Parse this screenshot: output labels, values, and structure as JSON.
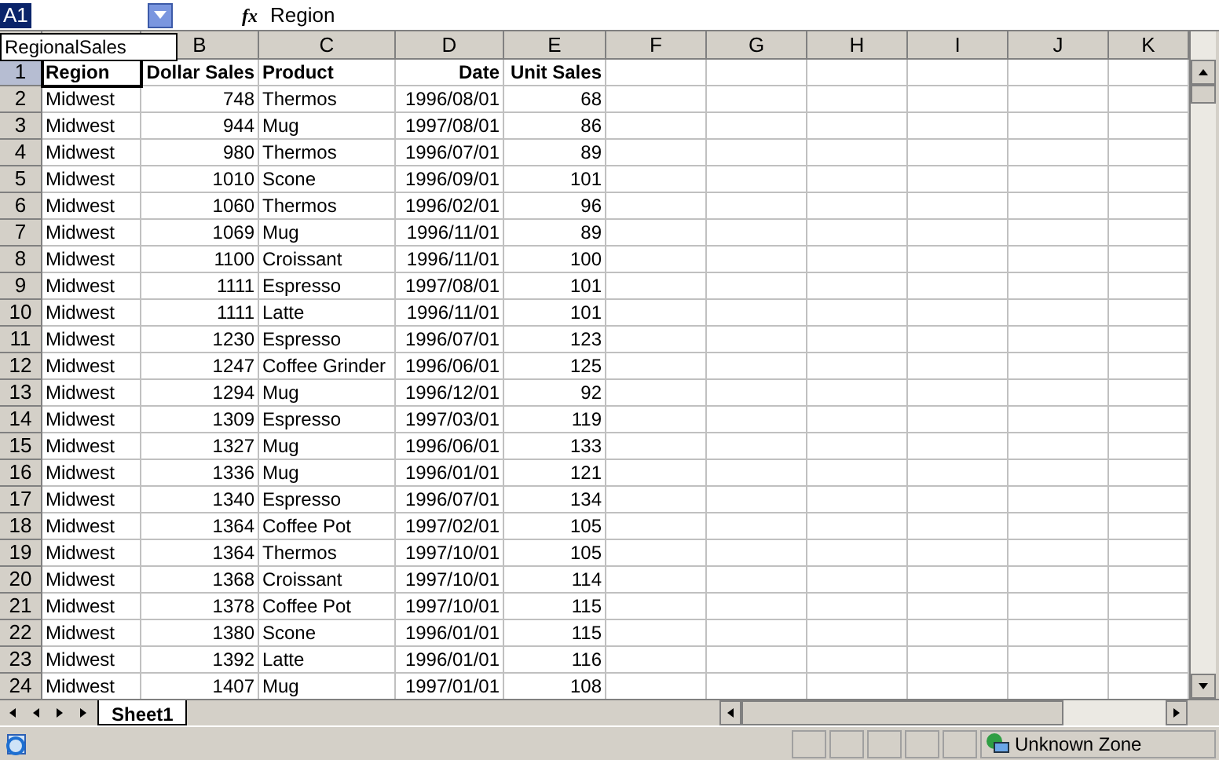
{
  "name_box": {
    "value": "A1"
  },
  "formula_bar": {
    "fx": "fx",
    "value": "Region"
  },
  "name_dropdown": {
    "item": "RegionalSales"
  },
  "column_headers": [
    "B",
    "C",
    "D",
    "E",
    "F",
    "G",
    "H",
    "I",
    "J",
    "K"
  ],
  "rows": [
    {
      "number": "1",
      "selected": true,
      "bold": true,
      "cells": [
        "Region",
        "Dollar Sales",
        "Product",
        "Date",
        "Unit Sales"
      ]
    },
    {
      "number": "2",
      "selected": false,
      "bold": false,
      "cells": [
        "Midwest",
        "748",
        "Thermos",
        "1996/08/01",
        "68"
      ]
    },
    {
      "number": "3",
      "selected": false,
      "bold": false,
      "cells": [
        "Midwest",
        "944",
        "Mug",
        "1997/08/01",
        "86"
      ]
    },
    {
      "number": "4",
      "selected": false,
      "bold": false,
      "cells": [
        "Midwest",
        "980",
        "Thermos",
        "1996/07/01",
        "89"
      ]
    },
    {
      "number": "5",
      "selected": false,
      "bold": false,
      "cells": [
        "Midwest",
        "1010",
        "Scone",
        "1996/09/01",
        "101"
      ]
    },
    {
      "number": "6",
      "selected": false,
      "bold": false,
      "cells": [
        "Midwest",
        "1060",
        "Thermos",
        "1996/02/01",
        "96"
      ]
    },
    {
      "number": "7",
      "selected": false,
      "bold": false,
      "cells": [
        "Midwest",
        "1069",
        "Mug",
        "1996/11/01",
        "89"
      ]
    },
    {
      "number": "8",
      "selected": false,
      "bold": false,
      "cells": [
        "Midwest",
        "1100",
        "Croissant",
        "1996/11/01",
        "100"
      ]
    },
    {
      "number": "9",
      "selected": false,
      "bold": false,
      "cells": [
        "Midwest",
        "1111",
        "Espresso",
        "1997/08/01",
        "101"
      ]
    },
    {
      "number": "10",
      "selected": false,
      "bold": false,
      "cells": [
        "Midwest",
        "1111",
        "Latte",
        "1996/11/01",
        "101"
      ]
    },
    {
      "number": "11",
      "selected": false,
      "bold": false,
      "cells": [
        "Midwest",
        "1230",
        "Espresso",
        "1996/07/01",
        "123"
      ]
    },
    {
      "number": "12",
      "selected": false,
      "bold": false,
      "cells": [
        "Midwest",
        "1247",
        "Coffee Grinder",
        "1996/06/01",
        "125"
      ]
    },
    {
      "number": "13",
      "selected": false,
      "bold": false,
      "cells": [
        "Midwest",
        "1294",
        "Mug",
        "1996/12/01",
        "92"
      ]
    },
    {
      "number": "14",
      "selected": false,
      "bold": false,
      "cells": [
        "Midwest",
        "1309",
        "Espresso",
        "1997/03/01",
        "119"
      ]
    },
    {
      "number": "15",
      "selected": false,
      "bold": false,
      "cells": [
        "Midwest",
        "1327",
        "Mug",
        "1996/06/01",
        "133"
      ]
    },
    {
      "number": "16",
      "selected": false,
      "bold": false,
      "cells": [
        "Midwest",
        "1336",
        "Mug",
        "1996/01/01",
        "121"
      ]
    },
    {
      "number": "17",
      "selected": false,
      "bold": false,
      "cells": [
        "Midwest",
        "1340",
        "Espresso",
        "1996/07/01",
        "134"
      ]
    },
    {
      "number": "18",
      "selected": false,
      "bold": false,
      "cells": [
        "Midwest",
        "1364",
        "Coffee Pot",
        "1997/02/01",
        "105"
      ]
    },
    {
      "number": "19",
      "selected": false,
      "bold": false,
      "cells": [
        "Midwest",
        "1364",
        "Thermos",
        "1997/10/01",
        "105"
      ]
    },
    {
      "number": "20",
      "selected": false,
      "bold": false,
      "cells": [
        "Midwest",
        "1368",
        "Croissant",
        "1997/10/01",
        "114"
      ]
    },
    {
      "number": "21",
      "selected": false,
      "bold": false,
      "cells": [
        "Midwest",
        "1378",
        "Coffee Pot",
        "1997/10/01",
        "115"
      ]
    },
    {
      "number": "22",
      "selected": false,
      "bold": false,
      "cells": [
        "Midwest",
        "1380",
        "Scone",
        "1996/01/01",
        "115"
      ]
    },
    {
      "number": "23",
      "selected": false,
      "bold": false,
      "cells": [
        "Midwest",
        "1392",
        "Latte",
        "1996/01/01",
        "116"
      ]
    },
    {
      "number": "24",
      "selected": false,
      "bold": false,
      "cells": [
        "Midwest",
        "1407",
        "Mug",
        "1997/01/01",
        "108"
      ]
    }
  ],
  "sheet_tabs": [
    {
      "label": "Sheet1",
      "selected": true
    }
  ],
  "status_bar": {
    "zone": "Unknown Zone"
  }
}
